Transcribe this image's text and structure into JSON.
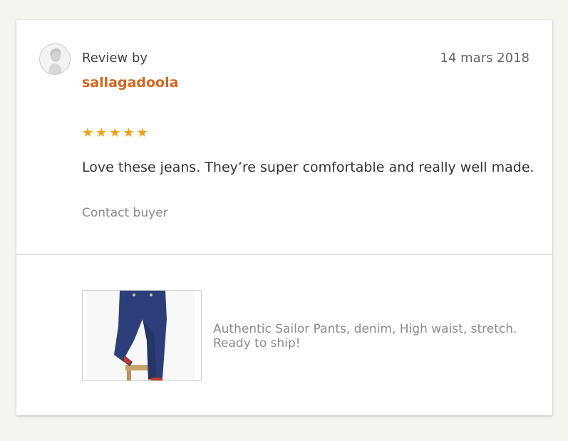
{
  "review": {
    "by_label": "Review by",
    "username": "sallagadoola",
    "date": "14 mars 2018",
    "rating": 5,
    "stars": [
      "★",
      "★",
      "★",
      "★",
      "★"
    ],
    "text": "Love these jeans. They’re super comfortable and really well made.",
    "contact_label": "Contact buyer"
  },
  "listing": {
    "title": "Authentic Sailor Pants, denim, High waist, stretch. Ready to ship!"
  },
  "colors": {
    "username": "#d5641c",
    "star": "#f1a00d",
    "background": "#f5f4ef"
  },
  "icons": {
    "avatar": "default-user-avatar-icon"
  }
}
